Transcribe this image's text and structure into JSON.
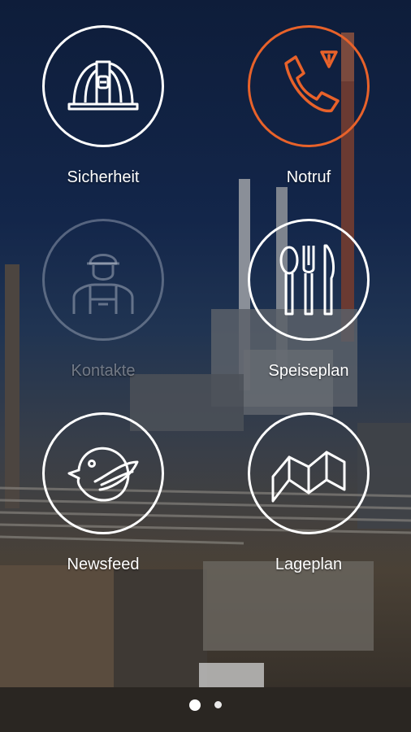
{
  "tiles": [
    {
      "id": "sicherheit",
      "label": "Sicherheit",
      "icon": "hard-hat-icon"
    },
    {
      "id": "notruf",
      "label": "Notruf",
      "icon": "emergency-phone-icon"
    },
    {
      "id": "kontakte",
      "label": "Kontakte",
      "icon": "worker-icon"
    },
    {
      "id": "speiseplan",
      "label": "Speiseplan",
      "icon": "cutlery-icon"
    },
    {
      "id": "newsfeed",
      "label": "Newsfeed",
      "icon": "bird-icon"
    },
    {
      "id": "lageplan",
      "label": "Lageplan",
      "icon": "map-icon"
    }
  ],
  "pager": {
    "pages": 2,
    "active": 1
  },
  "colors": {
    "accent": "#e8622a",
    "ring": "#ffffff",
    "label": "#ffffff"
  }
}
